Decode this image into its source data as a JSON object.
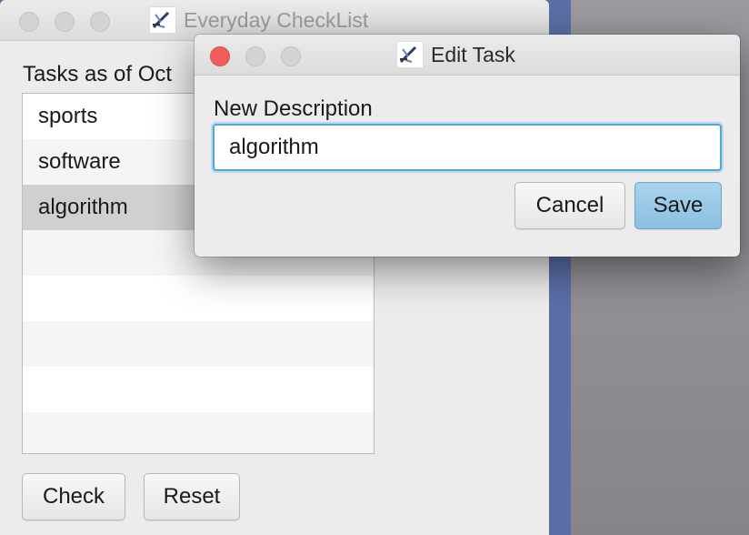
{
  "main_window": {
    "title": "Everyday CheckList",
    "tasks_label": "Tasks as of Oct",
    "tasks": [
      {
        "label": "sports",
        "selected": false
      },
      {
        "label": "software",
        "selected": false
      },
      {
        "label": "algorithm",
        "selected": true
      }
    ],
    "buttons": {
      "check": "Check",
      "reset": "Reset"
    }
  },
  "dialog": {
    "title": "Edit Task",
    "field_label": "New Description",
    "field_value": "algorithm",
    "buttons": {
      "cancel": "Cancel",
      "save": "Save"
    }
  },
  "colors": {
    "close_button_active": "#ee5f5b",
    "focus_ring": "#4fa9d8",
    "default_button": "#9ccae6",
    "selected_row": "#d0d0d0",
    "desktop": "#5b6fa6"
  },
  "icons": [
    "app-icon",
    "close-icon",
    "minimize-icon",
    "zoom-icon"
  ]
}
